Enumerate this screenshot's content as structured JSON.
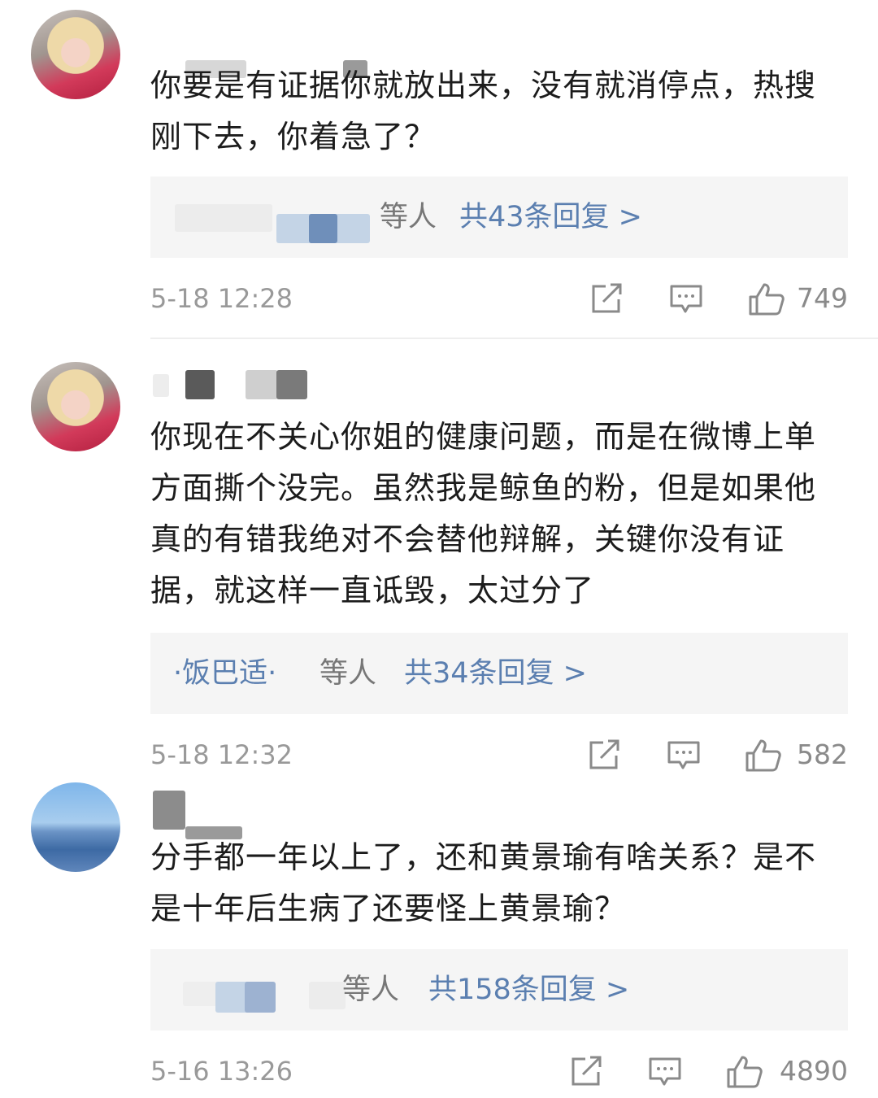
{
  "comments": [
    {
      "text": "你要是有证据你就放出来，没有就消停点，热搜刚下去，你着急了？",
      "reply": {
        "users": "",
        "suffix": "等人",
        "count": "共43条回复 >"
      },
      "time": "5-18 12:28",
      "likes": "749"
    },
    {
      "text": "你现在不关心你姐的健康问题，而是在微博上单方面撕个没完。虽然我是鲸鱼的粉，但是如果他真的有错我绝对不会替他辩解，关键你没有证据，就这样一直诋毁，太过分了",
      "reply": {
        "users": "·饭巴适·",
        "suffix": "等人",
        "count": "共34条回复 >"
      },
      "time": "5-18 12:32",
      "likes": "582"
    },
    {
      "text": "分手都一年以上了，还和黄景瑜有啥关系？是不是十年后生病了还要怪上黄景瑜？",
      "reply": {
        "users": "",
        "suffix": "等人",
        "count": "共158条回复 >"
      },
      "time": "5-16 13:26",
      "likes": "4890"
    }
  ],
  "icons": {
    "share": "share-icon",
    "comment": "comment-icon",
    "like": "thumbs-up-icon"
  },
  "colors": {
    "link": "#5b7fb0",
    "meta": "#999999",
    "reply_bg": "#f5f5f5"
  }
}
